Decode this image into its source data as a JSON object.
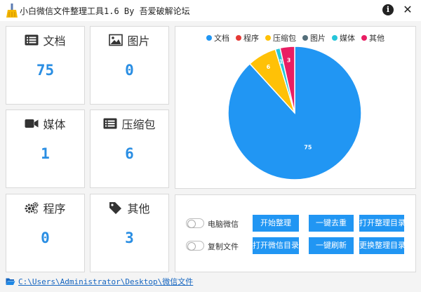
{
  "window": {
    "title": "小白微信文件整理工具1.6 By 吾爱破解论坛",
    "info_label": "i",
    "close_label": "✕"
  },
  "stats": [
    {
      "label": "文档",
      "value": "75",
      "icon": "document-icon"
    },
    {
      "label": "图片",
      "value": "0",
      "icon": "image-icon"
    },
    {
      "label": "媒体",
      "value": "1",
      "icon": "video-camera-icon"
    },
    {
      "label": "压缩包",
      "value": "6",
      "icon": "archive-icon"
    },
    {
      "label": "程序",
      "value": "0",
      "icon": "gears-icon"
    },
    {
      "label": "其他",
      "value": "3",
      "icon": "tag-icon"
    }
  ],
  "chart_data": {
    "type": "pie",
    "categories": [
      "文档",
      "程序",
      "压缩包",
      "图片",
      "媒体",
      "其他"
    ],
    "values": [
      75,
      0,
      6,
      0,
      1,
      3
    ],
    "colors": [
      "#2196f3",
      "#e53935",
      "#ffc107",
      "#546e7a",
      "#26c6da",
      "#e91e63"
    ],
    "slice_labels": [
      "75",
      "",
      "6",
      "",
      "1",
      "3"
    ],
    "legend_position": "top"
  },
  "options": {
    "pc_wechat": {
      "label": "电脑微信",
      "checked": false
    },
    "copy_files": {
      "label": "复制文件",
      "checked": false
    }
  },
  "buttons": {
    "start": "开始整理",
    "dedupe": "一键去重",
    "open_sorted_dir": "打开整理目录",
    "open_wechat_dir": "打开微信目录",
    "refresh": "一键刷新",
    "change_sorted_dir": "更换整理目录"
  },
  "path": {
    "text": "C:\\Users\\Administrator\\Desktop\\微信文件",
    "icon": "folder-open-icon"
  }
}
